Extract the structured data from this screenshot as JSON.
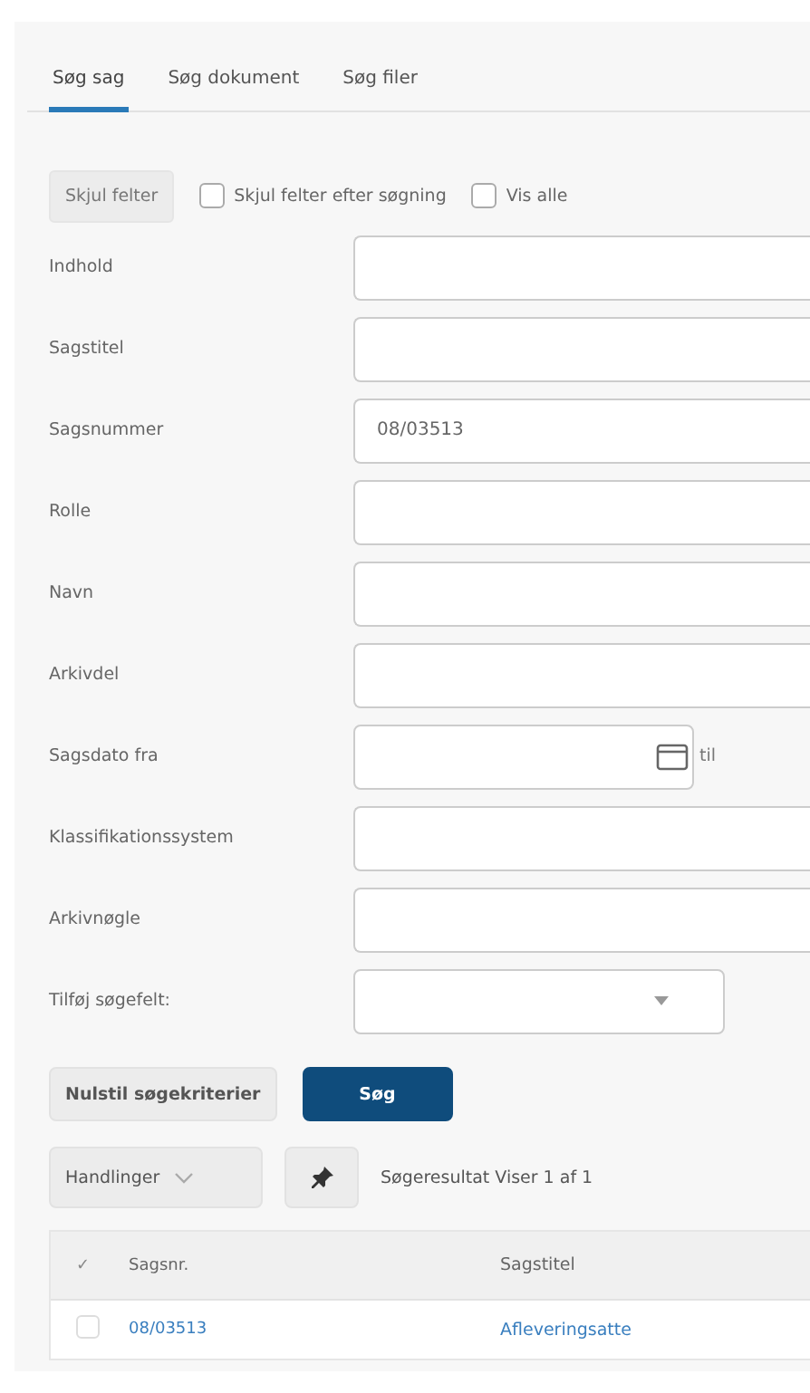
{
  "tabs": [
    {
      "label": "Søg sag",
      "selected": true
    },
    {
      "label": "Søg dokument",
      "selected": false
    },
    {
      "label": "Søg filer",
      "selected": false
    }
  ],
  "toolbar": {
    "toggle_button": "Skjul felter",
    "options": [
      {
        "label": "Skjul felter efter søgning",
        "checked": false
      },
      {
        "label": "Vis alle",
        "checked": false
      }
    ]
  },
  "fields": [
    {
      "kind": "text",
      "label": "Indhold"
    },
    {
      "kind": "text",
      "label": "Sagstitel"
    },
    {
      "kind": "text",
      "label": "Sagsnummer",
      "value": "08/03513"
    },
    {
      "kind": "text",
      "label": "Rolle"
    },
    {
      "kind": "text",
      "label": "Navn"
    },
    {
      "kind": "text",
      "label": "Arkivdel"
    },
    {
      "kind": "daterange",
      "label": "Sagsdato fra",
      "to_label": "til"
    },
    {
      "kind": "text",
      "label": "Klassifikationssystem"
    },
    {
      "kind": "text",
      "label": "Arkivnøgle"
    },
    {
      "kind": "select",
      "label": "Tilføj søgefelt:"
    }
  ],
  "buttons": {
    "reset": "Nulstil søgekriterier",
    "search": "Søg"
  },
  "results": {
    "actions": "Handlinger",
    "summary": "Søgeresultat Viser 1 af 1"
  },
  "table": {
    "check_header": "✓",
    "columns": [
      "Sagsnr.",
      "Sagstitel"
    ],
    "rows": [
      {
        "checked": false,
        "cells": [
          "08/03513",
          "Afleveringsatte"
        ]
      }
    ]
  }
}
